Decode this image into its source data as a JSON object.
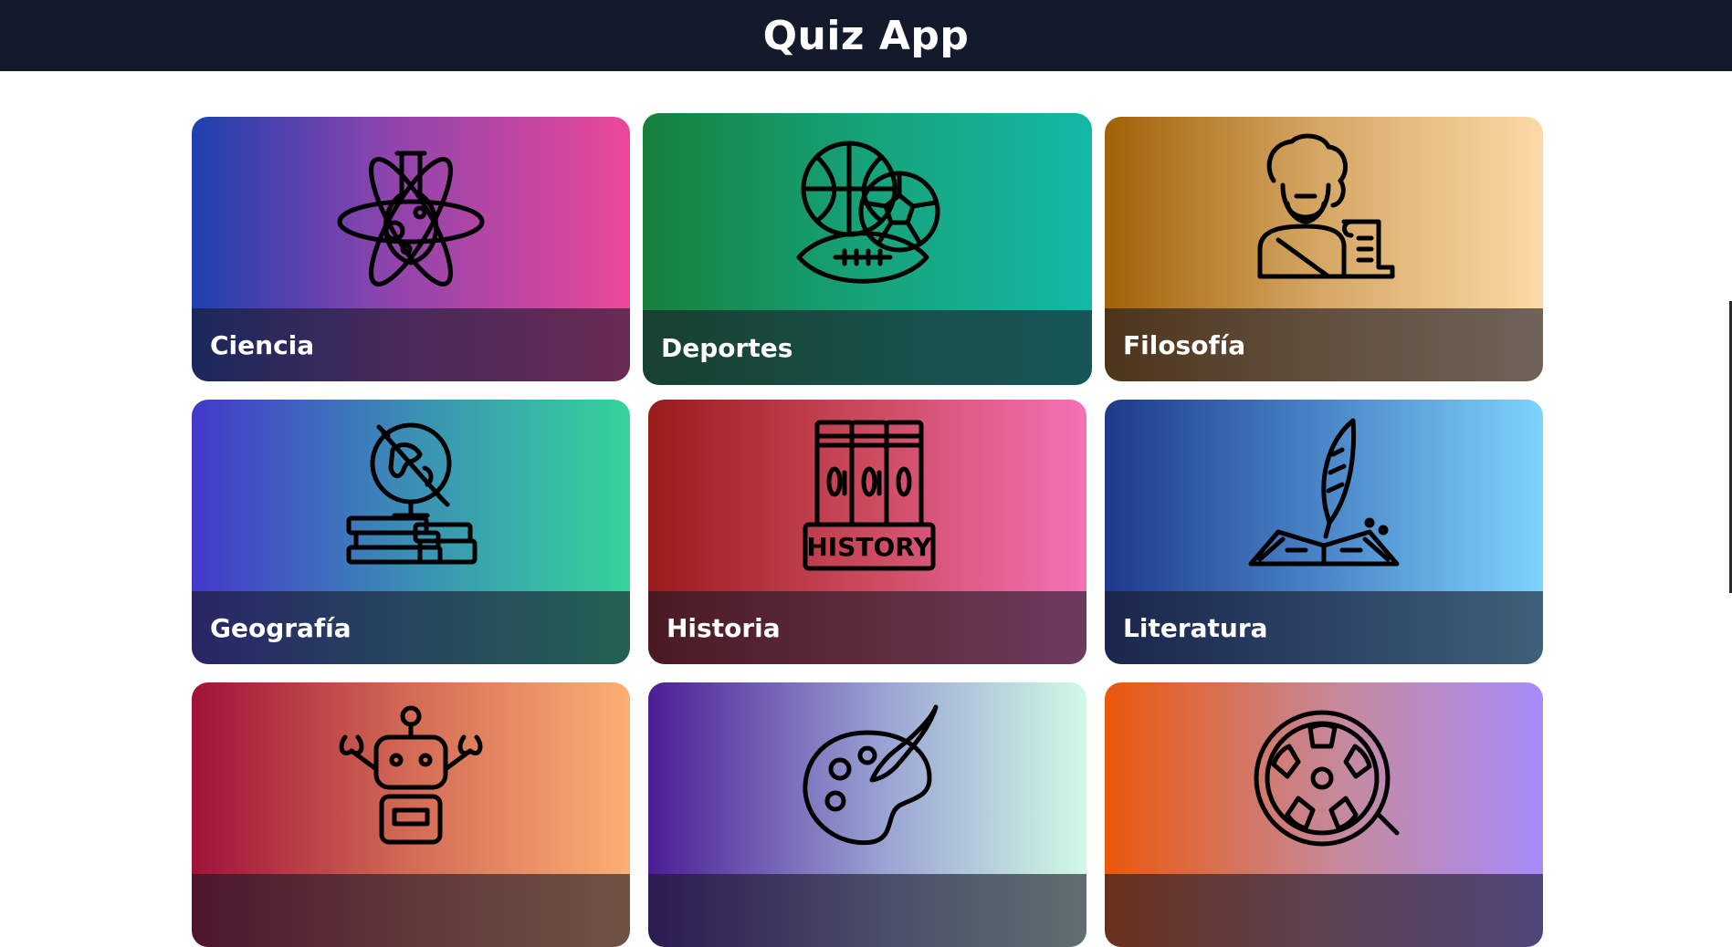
{
  "header": {
    "title": "Quiz App"
  },
  "categories": [
    {
      "label": "Ciencia",
      "icon": "science-flask-atom-icon"
    },
    {
      "label": "Deportes",
      "icon": "sports-balls-icon"
    },
    {
      "label": "Filosofía",
      "icon": "philosopher-scroll-icon"
    },
    {
      "label": "Geografía",
      "icon": "globe-books-icon"
    },
    {
      "label": "Historia",
      "icon": "history-books-icon",
      "icon_text": "HISTORY"
    },
    {
      "label": "Literatura",
      "icon": "quill-book-icon"
    },
    {
      "label": "",
      "icon": "robot-icon"
    },
    {
      "label": "",
      "icon": "art-palette-icon"
    },
    {
      "label": "",
      "icon": "film-reel-icon"
    }
  ],
  "colors": {
    "header_bg": "#131a2b",
    "page_bg": "#ffffff"
  }
}
